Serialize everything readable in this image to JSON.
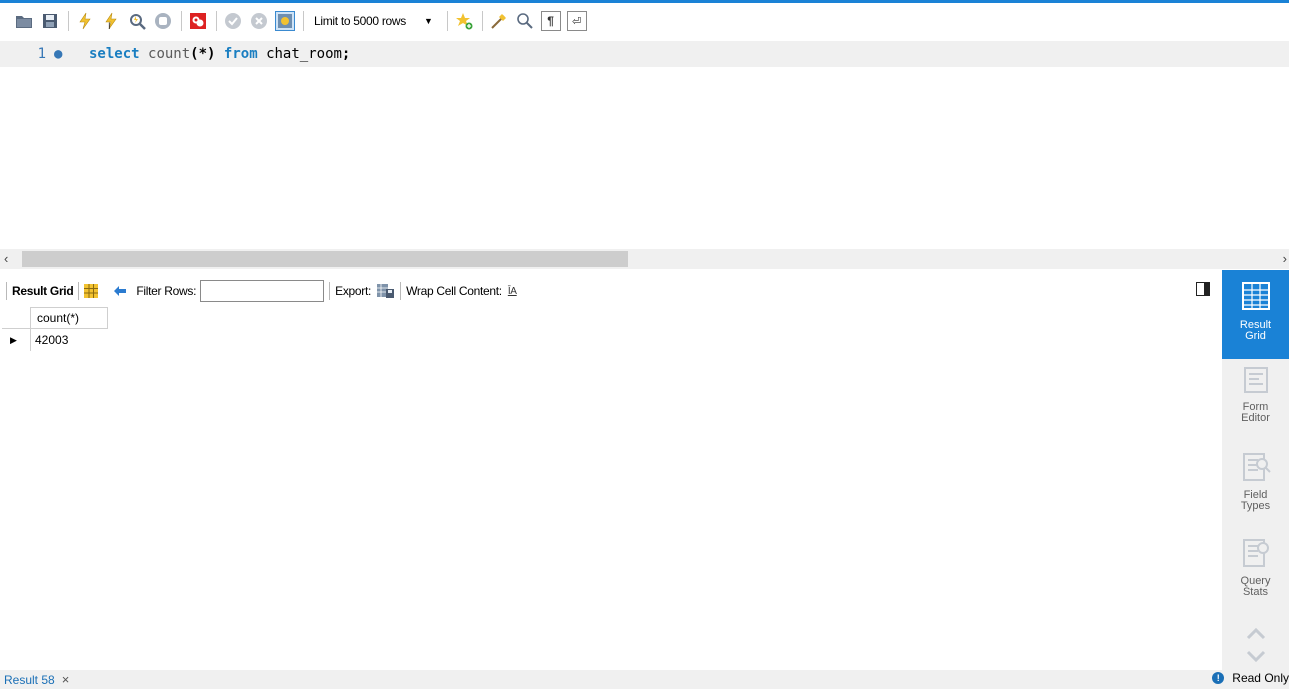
{
  "toolbar": {
    "limit_label": "Limit to 5000 rows",
    "icons": [
      "open-folder-icon",
      "save-icon",
      "execute-icon",
      "execute-current-icon",
      "explain-icon",
      "stop-icon",
      "toggle-error-icon",
      "commit-icon",
      "rollback-icon",
      "autocommit-icon",
      "limit-select",
      "add-snippet-icon",
      "beautify-icon",
      "find-icon",
      "invisible-chars-icon",
      "wrap-lines-icon"
    ]
  },
  "editor": {
    "line_number": "1",
    "line_marker": "●",
    "code": {
      "kw1": "select",
      "fn": "count",
      "op": "(*)",
      "kw2": "from",
      "table": "chat_room",
      "end": ";"
    }
  },
  "result_toolbar": {
    "result_grid": "Result Grid",
    "filter_rows": "Filter Rows:",
    "filter_value": "",
    "export": "Export:",
    "wrap_cell": "Wrap Cell Content:"
  },
  "grid": {
    "columns": [
      "count(*)"
    ],
    "rows": [
      [
        "42003"
      ]
    ],
    "row_marker": "▶"
  },
  "side_panel": {
    "items": [
      {
        "label_1": "Result",
        "label_2": "Grid",
        "active": true
      },
      {
        "label_1": "Form",
        "label_2": "Editor",
        "active": false
      },
      {
        "label_1": "Field",
        "label_2": "Types",
        "active": false
      },
      {
        "label_1": "Query",
        "label_2": "Stats",
        "active": false
      }
    ]
  },
  "bottom": {
    "tab_label": "Result 58",
    "close_glyph": "×",
    "status": "Read Only"
  },
  "colors": {
    "accent": "#1a82d6",
    "keyword": "#1a7ec1"
  }
}
